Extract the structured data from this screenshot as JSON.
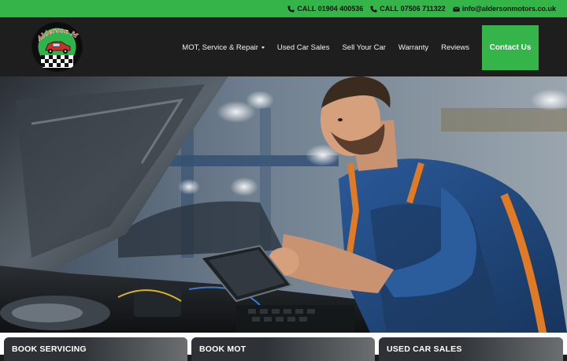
{
  "topbar": {
    "phone1": "CALL 01904 400536",
    "phone2": "CALL 07506 711322",
    "email": "info@aldersonmotors.co.uk",
    "phone_icon": "phone-icon",
    "email_icon": "envelope-icon"
  },
  "header": {
    "logo_text": "Alderson Motors Ltd",
    "nav": [
      {
        "label": "MOT, Service & Repair"
      },
      {
        "label": "Used Car Sales"
      },
      {
        "label": "Sell Your Car"
      },
      {
        "label": "Warranty"
      },
      {
        "label": "Reviews"
      }
    ],
    "contact_label": "Contact Us"
  },
  "cards": [
    {
      "label": "BOOK SERVICING"
    },
    {
      "label": "BOOK MOT"
    },
    {
      "label": "USED CAR SALES"
    }
  ],
  "colors": {
    "brand_green": "#34b449",
    "header_bg": "#1e1e1e"
  }
}
